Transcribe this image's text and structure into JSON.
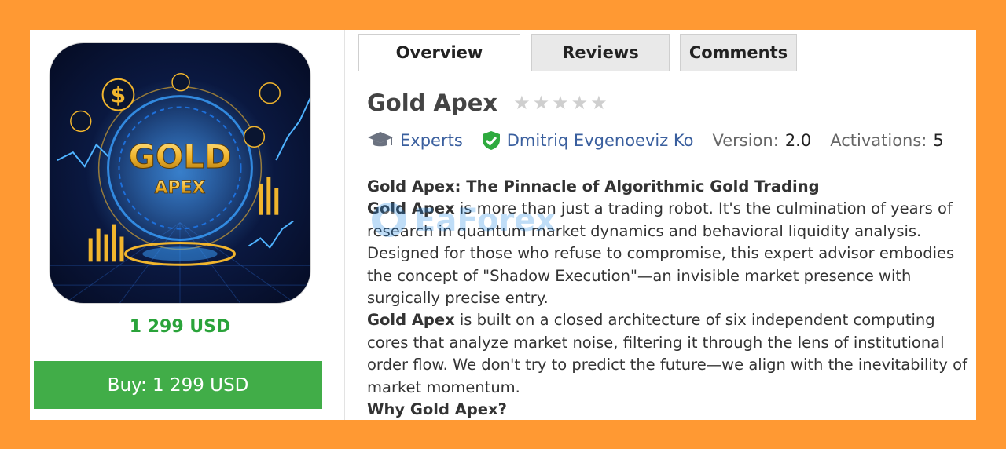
{
  "product": {
    "image_alt": "Gold Apex product image",
    "image_title": "GOLD",
    "image_subtitle": "APEX",
    "price": "1 299 USD",
    "buy_label": "Buy: 1 299 USD"
  },
  "tabs": [
    {
      "label": "Overview",
      "active": true
    },
    {
      "label": "Reviews",
      "active": false
    },
    {
      "label": "Comments",
      "active": false
    }
  ],
  "header": {
    "title": "Gold Apex",
    "rating": 0,
    "rating_max": 5
  },
  "meta": {
    "category_icon": "graduation-cap-icon",
    "category": "Experts",
    "seller_icon": "verified-shield-icon",
    "seller": "Dmitriq Evgenoeviz Ko",
    "version_label": "Version:",
    "version_value": "2.0",
    "activations_label": "Activations:",
    "activations_value": "5"
  },
  "description": {
    "heading": "Gold Apex: The Pinnacle of Algorithmic Gold Trading",
    "p1_bold": "Gold Apex",
    "p1_text": " is more than just a trading robot. It's the culmination of years of research in quantum market dynamics and behavioral liquidity analysis. Designed for those who refuse to compromise, this expert advisor embodies the concept of \"Shadow Execution\"—an invisible market presence with surgically precise entry.",
    "p2_bold": "Gold Apex",
    "p2_text": " is built on a closed architecture of six independent computing cores that analyze market noise, filtering it through the lens of institutional order flow. We don't try to predict the future—we align with the inevitability of market momentum.",
    "subheading": "Why Gold Apex?"
  },
  "watermark": {
    "text": "EaForex"
  },
  "colors": {
    "frame": "#ff9933",
    "accent_green": "#41ad48",
    "price_green": "#2aa33a",
    "link_blue": "#3a5f9e"
  }
}
